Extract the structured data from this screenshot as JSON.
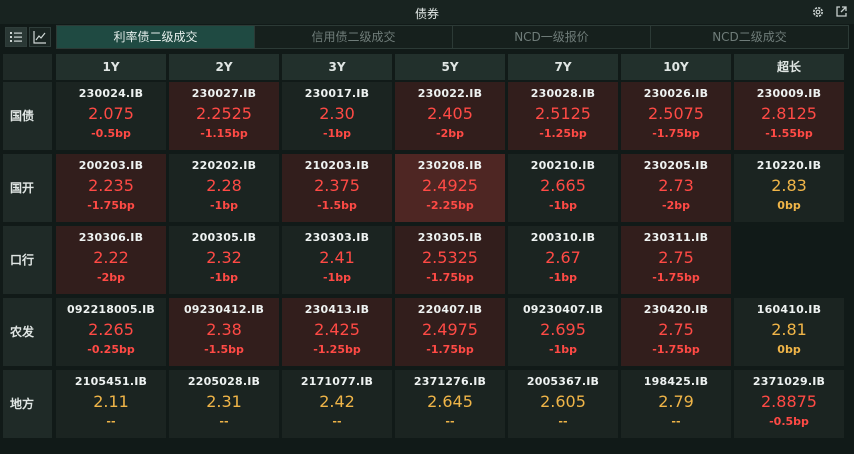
{
  "window": {
    "title": "债券"
  },
  "tabs": [
    {
      "label": "利率债二级成交",
      "active": true
    },
    {
      "label": "信用债二级成交",
      "active": false
    },
    {
      "label": "NCD一级报价",
      "active": false
    },
    {
      "label": "NCD二级成交",
      "active": false
    }
  ],
  "columns": [
    "1Y",
    "2Y",
    "3Y",
    "5Y",
    "7Y",
    "10Y",
    "超长"
  ],
  "rows": [
    {
      "label": "国债",
      "cells": [
        {
          "code": "230024.IB",
          "yield": "2.075",
          "change": "-0.5bp",
          "trend": "up",
          "bg": "dark"
        },
        {
          "code": "230027.IB",
          "yield": "2.2525",
          "change": "-1.15bp",
          "trend": "up",
          "bg": "red"
        },
        {
          "code": "230017.IB",
          "yield": "2.30",
          "change": "-1bp",
          "trend": "up",
          "bg": "dark"
        },
        {
          "code": "230022.IB",
          "yield": "2.405",
          "change": "-2bp",
          "trend": "up",
          "bg": "red"
        },
        {
          "code": "230028.IB",
          "yield": "2.5125",
          "change": "-1.25bp",
          "trend": "up",
          "bg": "red"
        },
        {
          "code": "230026.IB",
          "yield": "2.5075",
          "change": "-1.75bp",
          "trend": "up",
          "bg": "red"
        },
        {
          "code": "230009.IB",
          "yield": "2.8125",
          "change": "-1.55bp",
          "trend": "up",
          "bg": "red"
        }
      ]
    },
    {
      "label": "国开",
      "cells": [
        {
          "code": "200203.IB",
          "yield": "2.235",
          "change": "-1.75bp",
          "trend": "up",
          "bg": "red"
        },
        {
          "code": "220202.IB",
          "yield": "2.28",
          "change": "-1bp",
          "trend": "up",
          "bg": "dark"
        },
        {
          "code": "210203.IB",
          "yield": "2.375",
          "change": "-1.5bp",
          "trend": "up",
          "bg": "red"
        },
        {
          "code": "230208.IB",
          "yield": "2.4925",
          "change": "-2.25bp",
          "trend": "up",
          "bg": "deep"
        },
        {
          "code": "200210.IB",
          "yield": "2.665",
          "change": "-1bp",
          "trend": "up",
          "bg": "dark"
        },
        {
          "code": "230205.IB",
          "yield": "2.73",
          "change": "-2bp",
          "trend": "up",
          "bg": "red"
        },
        {
          "code": "210220.IB",
          "yield": "2.83",
          "change": "0bp",
          "trend": "flat",
          "bg": "dark"
        }
      ]
    },
    {
      "label": "口行",
      "cells": [
        {
          "code": "230306.IB",
          "yield": "2.22",
          "change": "-2bp",
          "trend": "up",
          "bg": "red"
        },
        {
          "code": "200305.IB",
          "yield": "2.32",
          "change": "-1bp",
          "trend": "up",
          "bg": "dark"
        },
        {
          "code": "230303.IB",
          "yield": "2.41",
          "change": "-1bp",
          "trend": "up",
          "bg": "dark"
        },
        {
          "code": "230305.IB",
          "yield": "2.5325",
          "change": "-1.75bp",
          "trend": "up",
          "bg": "red"
        },
        {
          "code": "200310.IB",
          "yield": "2.67",
          "change": "-1bp",
          "trend": "up",
          "bg": "dark"
        },
        {
          "code": "230311.IB",
          "yield": "2.75",
          "change": "-1.75bp",
          "trend": "up",
          "bg": "red"
        },
        null
      ]
    },
    {
      "label": "农发",
      "cells": [
        {
          "code": "092218005.IB",
          "yield": "2.265",
          "change": "-0.25bp",
          "trend": "up",
          "bg": "dark"
        },
        {
          "code": "09230412.IB",
          "yield": "2.38",
          "change": "-1.5bp",
          "trend": "up",
          "bg": "red"
        },
        {
          "code": "230413.IB",
          "yield": "2.425",
          "change": "-1.25bp",
          "trend": "up",
          "bg": "red"
        },
        {
          "code": "220407.IB",
          "yield": "2.4975",
          "change": "-1.75bp",
          "trend": "up",
          "bg": "red"
        },
        {
          "code": "09230407.IB",
          "yield": "2.695",
          "change": "-1bp",
          "trend": "up",
          "bg": "dark"
        },
        {
          "code": "230420.IB",
          "yield": "2.75",
          "change": "-1.75bp",
          "trend": "up",
          "bg": "red"
        },
        {
          "code": "160410.IB",
          "yield": "2.81",
          "change": "0bp",
          "trend": "flat",
          "bg": "dark"
        }
      ]
    },
    {
      "label": "地方",
      "cells": [
        {
          "code": "2105451.IB",
          "yield": "2.11",
          "change": "--",
          "trend": "flat",
          "bg": "dark"
        },
        {
          "code": "2205028.IB",
          "yield": "2.31",
          "change": "--",
          "trend": "flat",
          "bg": "dark"
        },
        {
          "code": "2171077.IB",
          "yield": "2.42",
          "change": "--",
          "trend": "flat",
          "bg": "dark"
        },
        {
          "code": "2371276.IB",
          "yield": "2.645",
          "change": "--",
          "trend": "flat",
          "bg": "dark"
        },
        {
          "code": "2005367.IB",
          "yield": "2.605",
          "change": "--",
          "trend": "flat",
          "bg": "dark"
        },
        {
          "code": "198425.IB",
          "yield": "2.79",
          "change": "--",
          "trend": "flat",
          "bg": "dark"
        },
        {
          "code": "2371029.IB",
          "yield": "2.8875",
          "change": "-0.5bp",
          "trend": "up",
          "bg": "dark"
        }
      ]
    }
  ],
  "colors": {
    "up": "#ff4a45",
    "flat": "#f0b548",
    "accent": "#1f4a42"
  },
  "icons": {
    "settings": "gear-icon",
    "popout": "external-link-icon",
    "list_view": "list-icon",
    "chart_view": "line-chart-icon"
  }
}
